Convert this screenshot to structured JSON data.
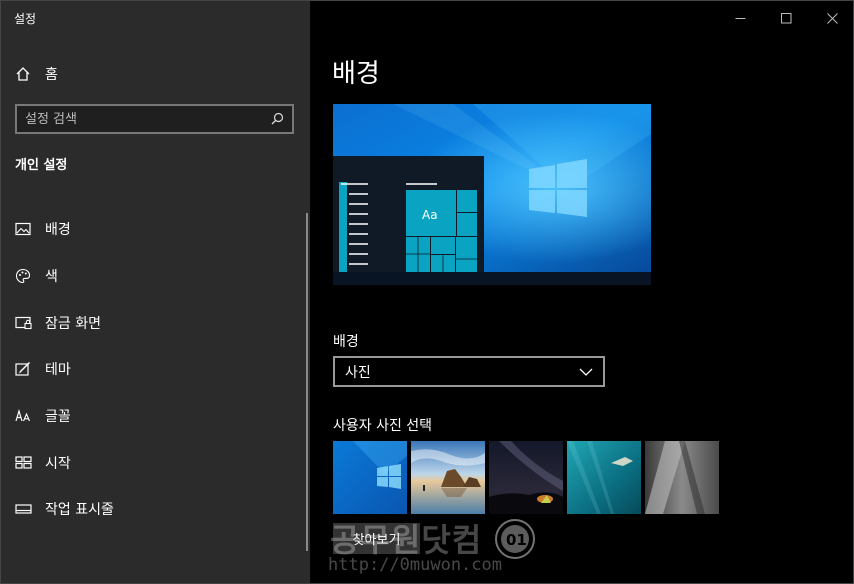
{
  "window": {
    "title": "설정"
  },
  "sidebar": {
    "home_label": "홈",
    "search_placeholder": "설정 검색",
    "section_title": "개인 설정",
    "items": [
      {
        "label": "배경",
        "icon": "picture-icon"
      },
      {
        "label": "색",
        "icon": "palette-icon"
      },
      {
        "label": "잠금 화면",
        "icon": "lock-screen-icon"
      },
      {
        "label": "테마",
        "icon": "theme-icon"
      },
      {
        "label": "글꼴",
        "icon": "font-icon"
      },
      {
        "label": "시작",
        "icon": "start-icon"
      },
      {
        "label": "작업 표시줄",
        "icon": "taskbar-icon"
      }
    ]
  },
  "main": {
    "title": "배경",
    "preview_tile_text": "Aa",
    "background_label": "배경",
    "background_value": "사진",
    "choose_label": "사용자 사진 선택",
    "browse_label": "찾아보기"
  },
  "watermark": {
    "text": "공무원닷컴",
    "url": "http://0muwon.com",
    "seal": "01"
  },
  "colors": {
    "sidebar_bg": "#2b2b2b",
    "main_bg": "#000000",
    "accent": "#0aa3c2"
  }
}
